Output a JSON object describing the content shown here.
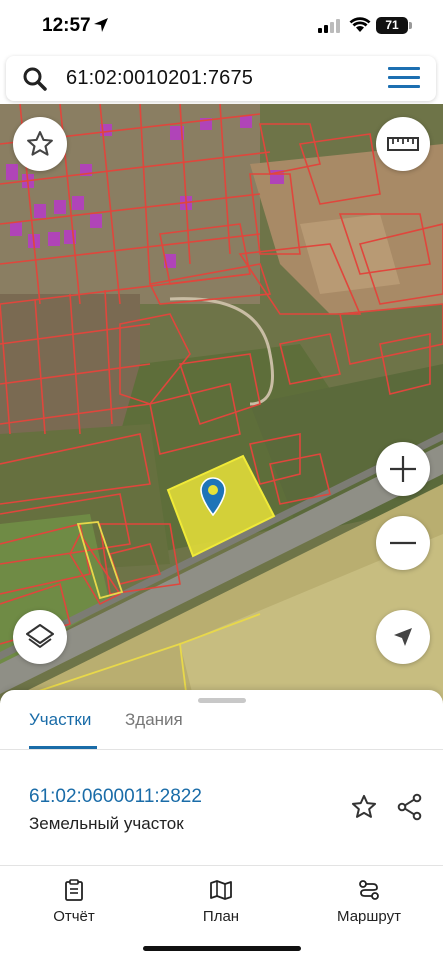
{
  "status_bar": {
    "time": "12:57",
    "battery": "71"
  },
  "search": {
    "query": "61:02:0010201:7675"
  },
  "map": {
    "buttons": [
      "favorites-star",
      "ruler",
      "zoom-in",
      "zoom-out",
      "layers",
      "locate"
    ],
    "highlight_color": "#e8e23a",
    "boundary_color": "#e0463c"
  },
  "sheet": {
    "tabs": [
      {
        "label": "Участки",
        "active": true
      },
      {
        "label": "Здания",
        "active": false
      }
    ],
    "result": {
      "id": "61:02:0600011:2822",
      "type": "Земельный участок"
    }
  },
  "bottom_nav": {
    "items": [
      {
        "label": "Отчёт",
        "icon": "report-icon"
      },
      {
        "label": "План",
        "icon": "map-plan-icon"
      },
      {
        "label": "Маршрут",
        "icon": "route-icon"
      }
    ]
  },
  "colors": {
    "accent": "#1a6ca8",
    "menu": "#1c6fb1"
  }
}
